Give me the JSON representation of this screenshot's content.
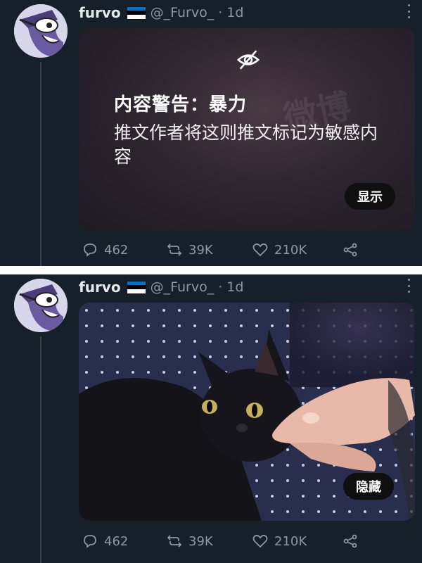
{
  "tweets": [
    {
      "author": {
        "name": "furvo",
        "handle": "@_Furvo_",
        "separator": "·",
        "time": "1d"
      },
      "avatar_icon": "cartoon-avatar-icon",
      "media": {
        "type": "content-warning",
        "icon": "eye-off-icon",
        "warning_title": "内容警告：暴力",
        "warning_text": "推文作者将这则推文标记为敏感内容",
        "watermark": "微博",
        "button_label": "显示"
      },
      "actions": {
        "replies": "462",
        "retweets": "39K",
        "likes": "210K"
      }
    },
    {
      "author": {
        "name": "furvo",
        "handle": "@_Furvo_",
        "separator": "·",
        "time": "1d"
      },
      "avatar_icon": "cartoon-avatar-icon",
      "media": {
        "type": "photo",
        "description_icon": "black-cat-photo",
        "button_label": "隐藏"
      },
      "actions": {
        "replies": "462",
        "retweets": "39K",
        "likes": "210K"
      }
    }
  ],
  "colors": {
    "background": "#15202b",
    "muted": "#8b98a5",
    "divider": "#ffffff",
    "flag": [
      "#0072ce",
      "#000000",
      "#ffffff"
    ]
  }
}
